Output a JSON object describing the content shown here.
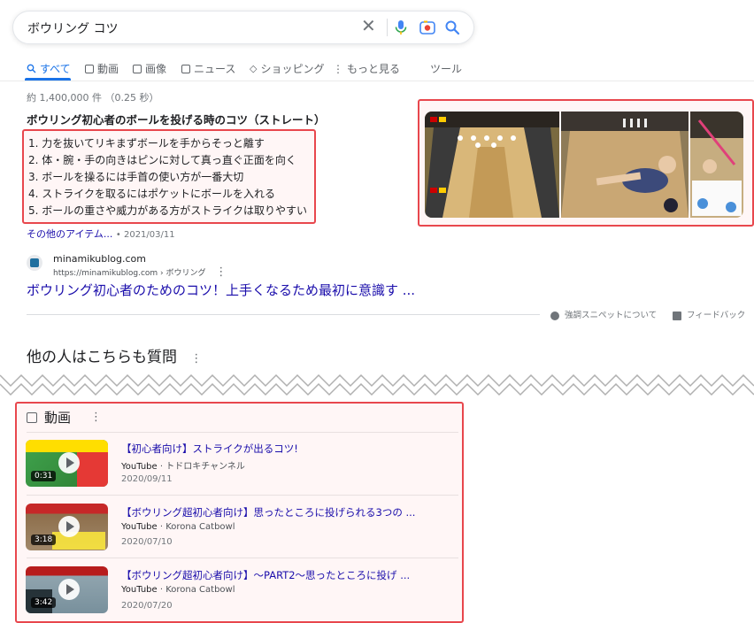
{
  "search": {
    "query": "ボウリング コツ",
    "clear_symbol": "✕"
  },
  "tabs": [
    {
      "label": "すべて",
      "icon": "search-icon",
      "active": true
    },
    {
      "label": "動画",
      "icon": "video-icon"
    },
    {
      "label": "画像",
      "icon": "image-icon"
    },
    {
      "label": "ニュース",
      "icon": "news-icon"
    },
    {
      "label": "ショッピング",
      "icon": "tag-icon"
    },
    {
      "label": "もっと見る",
      "icon": "more-vert-icon"
    }
  ],
  "tools_label": "ツール",
  "results_stats": "約 1,400,000 件 （0.25 秒）",
  "featured_snippet": {
    "title": "ボウリング初心者のボールを投げる時のコツ（ストレート）",
    "items": [
      "1. 力を抜いてリキまずボールを手からそっと離す",
      "2. 体・腕・手の向きはピンに対して真っ直ぐ正面を向く",
      "3. ボールを操るには手首の使い方が一番大切",
      "4. ストライクを取るにはポケットにボールを入れる",
      "5. ボールの重さや威力がある方がストライクは取りやすい"
    ],
    "more_items_label": "その他のアイテム...",
    "date": "2021/03/11"
  },
  "source": {
    "site_name": "minamikublog.com",
    "breadcrumb": "https://minamikublog.com › ボウリング",
    "title": "ボウリング初心者のためのコツ！上手くなるため最初に意識す ..."
  },
  "snippet_footer": {
    "about_label": "強調スニペットについて",
    "feedback_label": "フィードバック"
  },
  "people_also_ask": {
    "title": "他の人はこちらも質問"
  },
  "videos": {
    "heading": "動画",
    "items": [
      {
        "title": "【初心者向け】ストライクが出るコツ!",
        "platform": "YouTube",
        "channel": "トドロキチャンネル",
        "date": "2020/09/11",
        "duration": "0:31"
      },
      {
        "title": "【ボウリング超初心者向け】思ったところに投げられる3つの ...",
        "platform": "YouTube",
        "channel": "Korona Catbowl",
        "date": "2020/07/10",
        "duration": "3:18"
      },
      {
        "title": "【ボウリング超初心者向け】～PART2～思ったところに投げ ...",
        "platform": "YouTube",
        "channel": "Korona Catbowl",
        "date": "2020/07/20",
        "duration": "3:42"
      }
    ]
  },
  "colors": {
    "accent": "#1a73e8",
    "link": "#1a0dab",
    "highlight_border": "#e8474d",
    "highlight_fill": "#fff6f6"
  }
}
